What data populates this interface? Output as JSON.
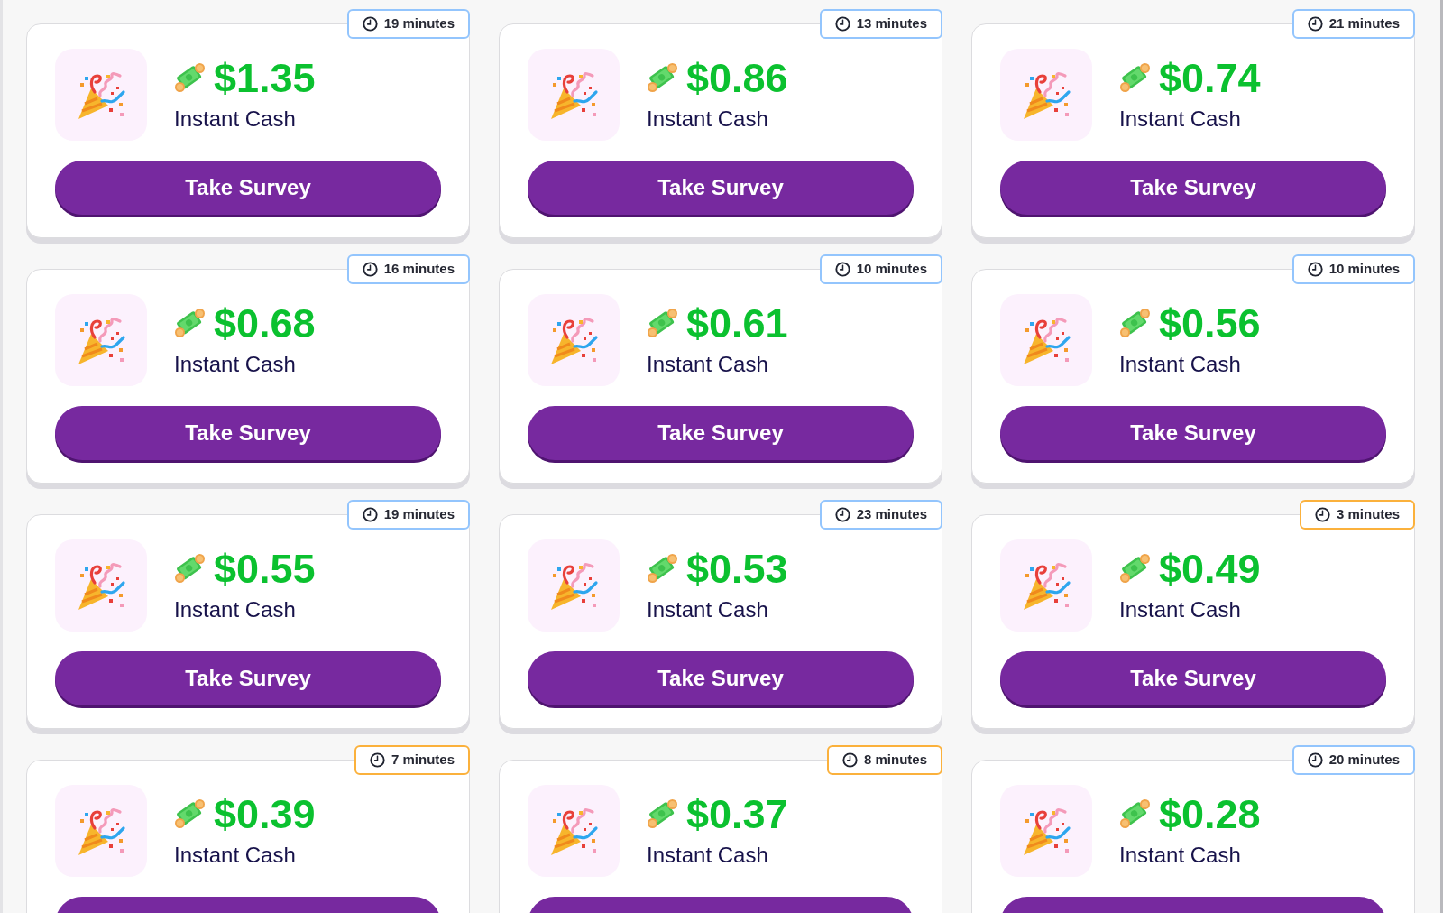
{
  "surveys": [
    {
      "duration": "19 minutes",
      "color": "#93c5fd",
      "price": "$1.35",
      "label": "Instant Cash",
      "button": "Take Survey"
    },
    {
      "duration": "13 minutes",
      "color": "#93c5fd",
      "price": "$0.86",
      "label": "Instant Cash",
      "button": "Take Survey"
    },
    {
      "duration": "21 minutes",
      "color": "#93c5fd",
      "price": "$0.74",
      "label": "Instant Cash",
      "button": "Take Survey"
    },
    {
      "duration": "16 minutes",
      "color": "#93c5fd",
      "price": "$0.68",
      "label": "Instant Cash",
      "button": "Take Survey"
    },
    {
      "duration": "10 minutes",
      "color": "#93c5fd",
      "price": "$0.61",
      "label": "Instant Cash",
      "button": "Take Survey"
    },
    {
      "duration": "10 minutes",
      "color": "#93c5fd",
      "price": "$0.56",
      "label": "Instant Cash",
      "button": "Take Survey"
    },
    {
      "duration": "19 minutes",
      "color": "#93c5fd",
      "price": "$0.55",
      "label": "Instant Cash",
      "button": "Take Survey"
    },
    {
      "duration": "23 minutes",
      "color": "#93c5fd",
      "price": "$0.53",
      "label": "Instant Cash",
      "button": "Take Survey"
    },
    {
      "duration": "3 minutes",
      "color": "#fbb13c",
      "price": "$0.49",
      "label": "Instant Cash",
      "button": "Take Survey"
    },
    {
      "duration": "7 minutes",
      "color": "#fbb13c",
      "price": "$0.39",
      "label": "Instant Cash"
    },
    {
      "duration": "8 minutes",
      "color": "#fbb13c",
      "price": "$0.37",
      "label": "Instant Cash"
    },
    {
      "duration": "20 minutes",
      "color": "#93c5fd",
      "price": "$0.28",
      "label": "Instant Cash"
    }
  ]
}
